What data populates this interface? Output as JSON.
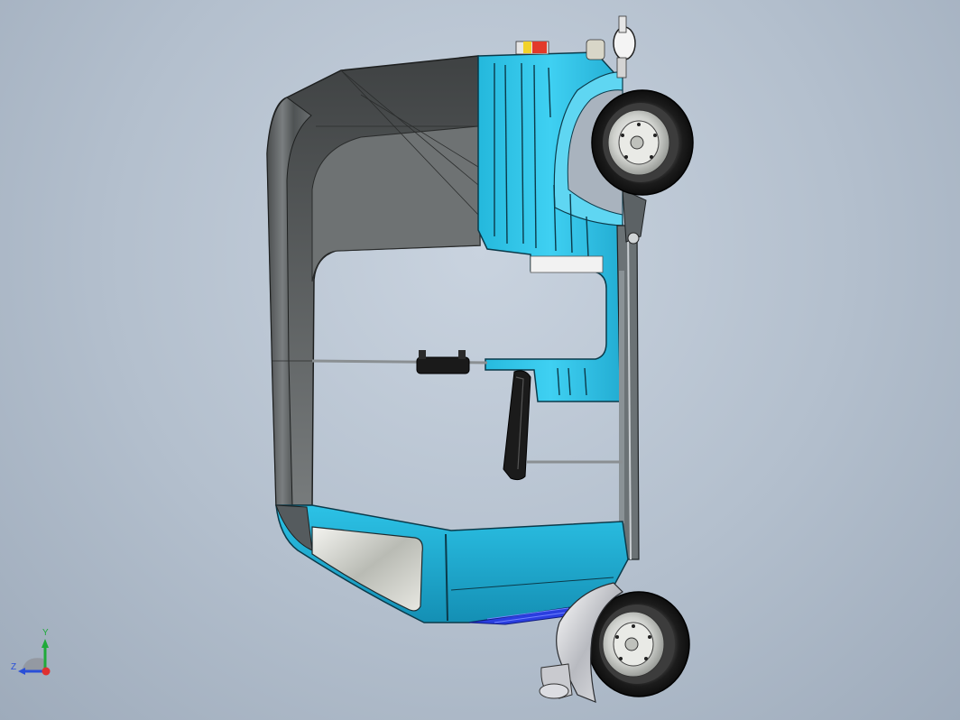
{
  "viewport": {
    "background_top": "#c9d3df",
    "background_bottom": "#9eabbb"
  },
  "model": {
    "body_color": "#2fc4e8",
    "shell_color": "#5e6263",
    "tire_color": "#2b2b2b",
    "wheel_count": 2
  },
  "triad": {
    "axis_y": "Y",
    "axis_z": "Z",
    "y_color": "#1faa3a",
    "z_color": "#2a4fd8",
    "x_color": "#e03030"
  }
}
